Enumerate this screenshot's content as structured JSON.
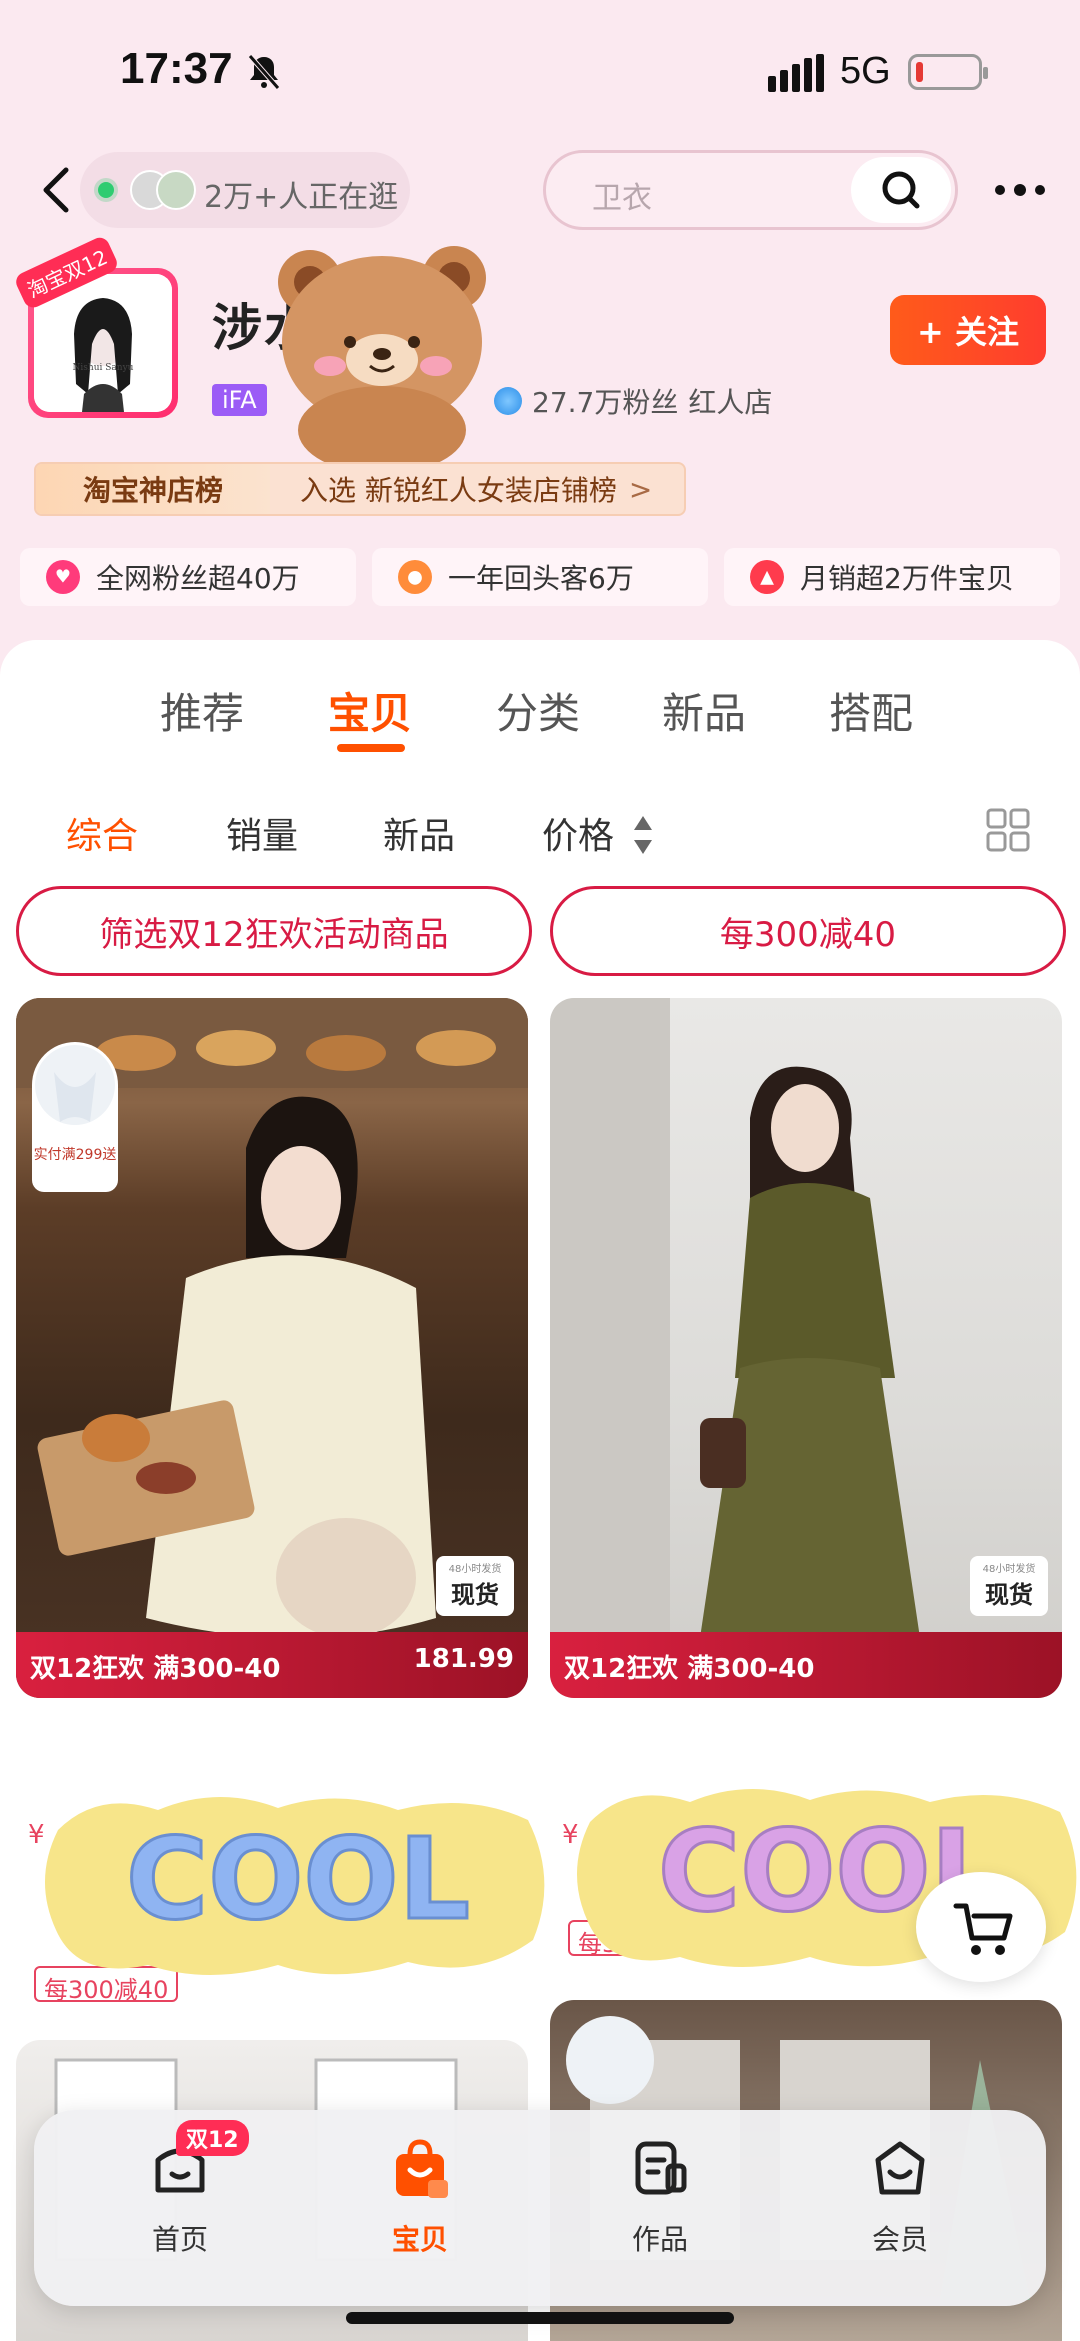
{
  "status": {
    "time": "17:37",
    "network": "5G"
  },
  "topnav": {
    "live_text": "2万+人正在逛",
    "search_placeholder": "卫衣"
  },
  "shop": {
    "name": "涉水三鱼",
    "brand_tag": "iFA",
    "fans": "27.7万粉丝",
    "shop_type": "红人店",
    "follow_label": "+ 关注",
    "avatar_badge": "淘宝双12",
    "rank_label": "淘宝神店榜",
    "rank_text": "入选 新锐红人女装店铺榜",
    "rank_chevron": ">",
    "stats": [
      {
        "label": "全网粉丝超40万"
      },
      {
        "label": "一年回头客6万"
      },
      {
        "label": "月销超2万件宝贝"
      }
    ]
  },
  "tabs": [
    "推荐",
    "宝贝",
    "分类",
    "新品",
    "搭配"
  ],
  "sorts": [
    "综合",
    "销量",
    "新品",
    "价格"
  ],
  "promos": [
    "筛选双12狂欢活动商品",
    "每300减40"
  ],
  "products": [
    {
      "strip_text": "双12狂欢 满300-40",
      "price_text": "181.99",
      "badge": "现货",
      "gift_text": "实付满299送",
      "coupon": "每300减40",
      "price_symbol": "¥"
    },
    {
      "strip_text": "双12狂欢 满300-40",
      "badge": "现货",
      "coupon": "每300减40",
      "price_symbol": "¥"
    }
  ],
  "sticker_text": "COOL",
  "bottomnav": [
    {
      "label": "首页",
      "badge": "双12"
    },
    {
      "label": "宝贝"
    },
    {
      "label": "作品"
    },
    {
      "label": "会员"
    }
  ],
  "colors": {
    "accent": "#ff5000",
    "promo_red": "#d81b44",
    "page_bg": "#fbe9f0"
  }
}
